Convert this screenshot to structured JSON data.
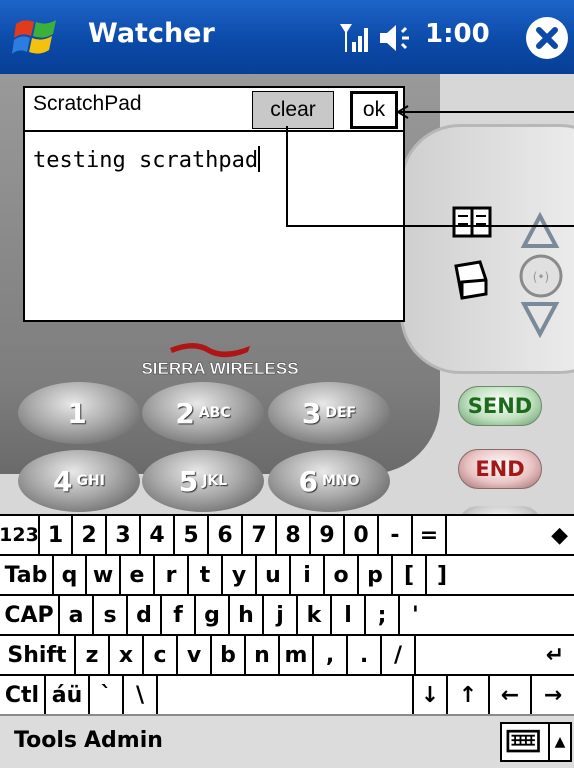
{
  "titlebar": {
    "app_title": "Watcher",
    "clock": "1:00",
    "icons": [
      "windows-start-icon",
      "signal-icon",
      "speaker-icon",
      "close-icon"
    ]
  },
  "device": {
    "brand": "SIERRA WIRELESS",
    "keypad": [
      {
        "num": "1",
        "sub": ""
      },
      {
        "num": "2",
        "sub": "ABC"
      },
      {
        "num": "3",
        "sub": "DEF"
      },
      {
        "num": "4",
        "sub": "GHI"
      },
      {
        "num": "5",
        "sub": "JKL"
      },
      {
        "num": "6",
        "sub": "MNO"
      }
    ],
    "send_label": "SEND",
    "end_label": "END",
    "nav_icons": [
      "phonebook-icon",
      "notes-icon",
      "up-arrow-icon",
      "center-select-icon",
      "down-arrow-icon"
    ]
  },
  "scratchpad": {
    "title": "ScratchPad",
    "clear_label": "clear",
    "ok_label": "ok",
    "text": "testing scrathpad"
  },
  "keyboard": {
    "rows": [
      [
        "123",
        "1",
        "2",
        "3",
        "4",
        "5",
        "6",
        "7",
        "8",
        "9",
        "0",
        "-",
        "=",
        "◆"
      ],
      [
        "Tab",
        "q",
        "w",
        "e",
        "r",
        "t",
        "y",
        "u",
        "i",
        "o",
        "p",
        "[",
        "]"
      ],
      [
        "CAP",
        "a",
        "s",
        "d",
        "f",
        "g",
        "h",
        "j",
        "k",
        "l",
        ";",
        "'"
      ],
      [
        "Shift",
        "z",
        "x",
        "c",
        "v",
        "b",
        "n",
        "m",
        ",",
        ".",
        "/",
        "↵"
      ],
      [
        "Ctl",
        "áü",
        "`",
        "\\",
        "",
        "↓",
        "↑",
        "←",
        "→"
      ]
    ]
  },
  "menubar": {
    "tools_label": "Tools",
    "admin_label": "Admin",
    "sip_icon": "keyboard-icon",
    "sip_arrow": "▲"
  },
  "colors": {
    "titlebar_blue": "#0b4aa8",
    "send_green": "#1d6a1d",
    "end_red": "#a01818"
  }
}
